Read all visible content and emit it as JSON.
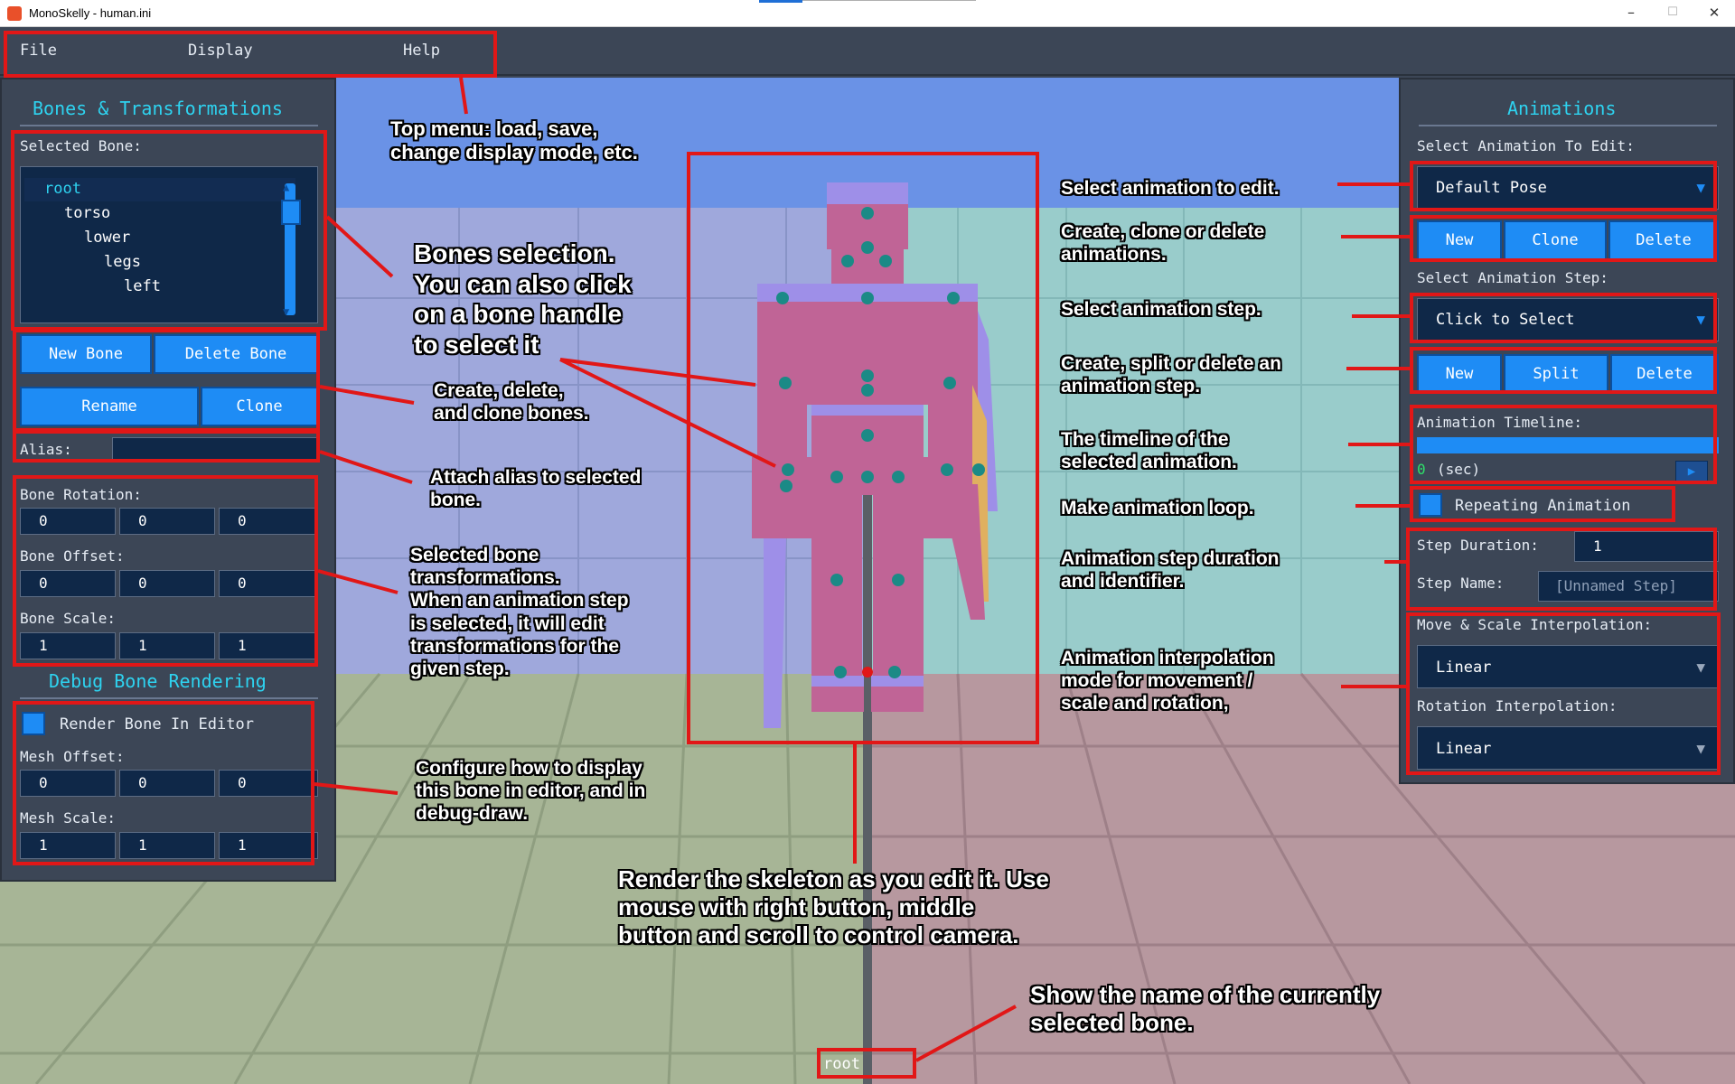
{
  "window": {
    "title": "MonoSkelly - human.ini",
    "minimize": "–",
    "maximize": "☐",
    "close": "✕"
  },
  "menu": {
    "items": [
      "File",
      "Display",
      "Help"
    ]
  },
  "left_panel": {
    "title": "Bones & Transformations",
    "selected_bone_label": "Selected Bone:",
    "tree": [
      "root",
      "torso",
      "lower",
      "legs",
      "left"
    ],
    "buttons": {
      "new_bone": "New Bone",
      "delete_bone": "Delete Bone",
      "rename": "Rename",
      "clone": "Clone"
    },
    "alias_label": "Alias:",
    "alias_value": "",
    "rotation_label": "Bone Rotation:",
    "rotation": [
      "0",
      "0",
      "0"
    ],
    "offset_label": "Bone Offset:",
    "offset": [
      "0",
      "0",
      "0"
    ],
    "scale_label": "Bone Scale:",
    "scale": [
      "1",
      "1",
      "1"
    ],
    "debug_title": "Debug Bone Rendering",
    "render_in_editor_label": "Render Bone In Editor",
    "mesh_offset_label": "Mesh Offset:",
    "mesh_offset": [
      "0",
      "0",
      "0"
    ],
    "mesh_scale_label": "Mesh Scale:",
    "mesh_scale": [
      "1",
      "1",
      "1"
    ]
  },
  "right_panel": {
    "title": "Animations",
    "select_anim_label": "Select Animation To Edit:",
    "selected_anim": "Default Pose",
    "anim_buttons": [
      "New",
      "Clone",
      "Delete"
    ],
    "select_step_label": "Select Animation Step:",
    "selected_step": "Click to Select",
    "step_buttons": [
      "New",
      "Split",
      "Delete"
    ],
    "timeline_label": "Animation Timeline:",
    "timeline_time": "0",
    "timeline_unit": "(sec)",
    "play_icon": "▶",
    "repeating_label": "Repeating Animation",
    "step_duration_label": "Step Duration:",
    "step_duration": "1",
    "step_name_label": "Step Name:",
    "step_name_placeholder": "[Unnamed Step]",
    "move_scale_interp_label": "Move & Scale Interpolation:",
    "move_scale_interp": "Linear",
    "rotation_interp_label": "Rotation Interpolation:",
    "rotation_interp": "Linear",
    "dropdown_arrow": "▼"
  },
  "current_bone": "root",
  "annotations": {
    "top_menu": "Top menu: load, save,\nchange display mode, etc.",
    "bones_selection": "Bones selection.\nYou can also click\non a bone handle\nto select it",
    "create_bones": "Create, delete,\nand clone bones.",
    "alias": "Attach alias to selected\nbone.",
    "transforms": "Selected bone\ntransformations.\nWhen an animation step\nis selected, it will edit\ntransformations for the\ngiven step.",
    "debug_render": "Configure how to display\nthis bone in editor, and in\ndebug-draw.",
    "select_anim": "Select animation to edit.",
    "anim_crud": "Create, clone or delete\nanimations.",
    "select_step": "Select animation step.",
    "step_crud": "Create, split or delete an\nanimation step.",
    "timeline": "The timeline of the\nselected animation.",
    "loop": "Make animation loop.",
    "step_duration": "Animation step duration\nand identifier.",
    "interp": "Animation interpolation\nmode for movement /\nscale and rotation,",
    "render": "Render the skeleton as you edit it. Use\nmouse with right button, middle\nbutton  and scroll to control camera.",
    "bone_name": "Show the name of the currently\nselected bone."
  },
  "colors": {
    "accent": "#1e8cf5",
    "title_cyan": "#2ed3f0",
    "callout_red": "#e11717",
    "panel_bg": "#3c4656",
    "field_bg": "#0f2848"
  }
}
